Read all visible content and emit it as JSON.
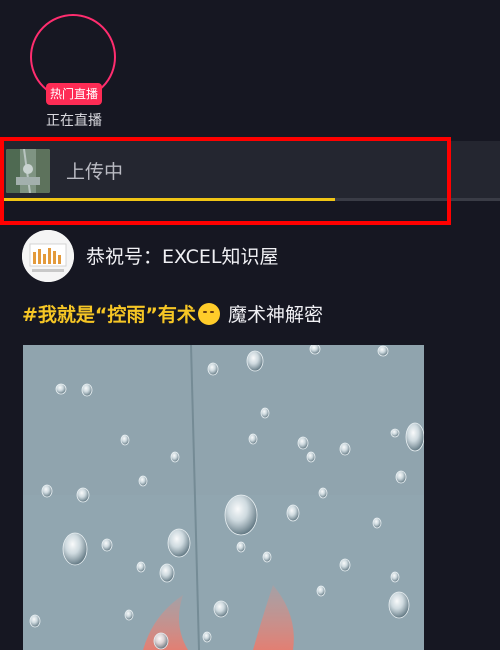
{
  "live": {
    "badge": "热门直播",
    "caption": "正在直播"
  },
  "upload": {
    "status": "上传中",
    "progress_percent": 67
  },
  "post": {
    "author": "恭祝号：EXCEL知识屋",
    "caption_tag": "#我就是“控雨”有术",
    "caption_rest": " 魔术神解密",
    "emoji_icon": "smirk-emoji-icon"
  },
  "colors": {
    "background": "#161722",
    "live_accent": "#fe2c55",
    "progress": "#f0c515",
    "highlight": "#ff0000",
    "tag": "#f6c625"
  }
}
